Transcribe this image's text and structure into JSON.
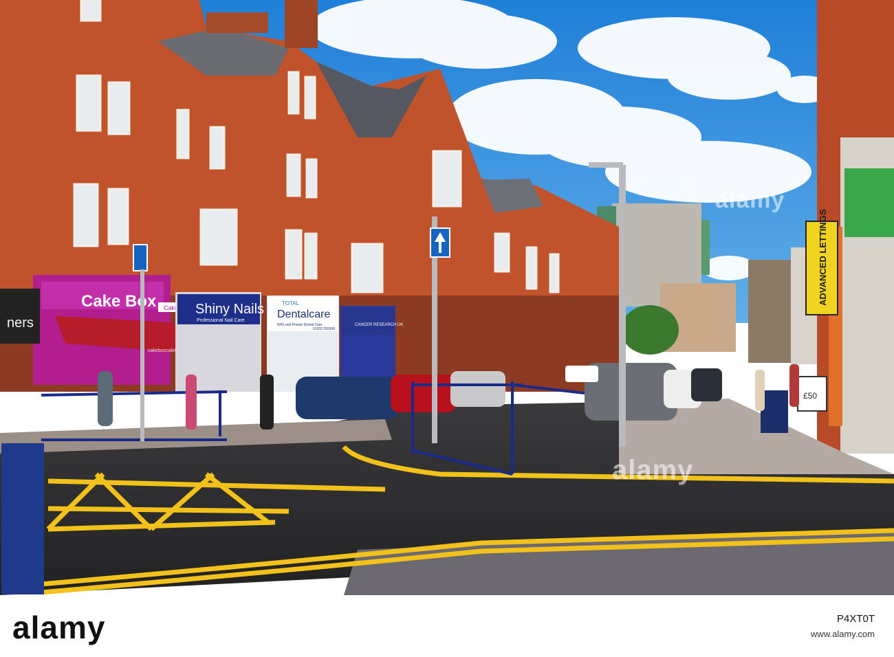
{
  "signs": {
    "cake_box": "Cake Box",
    "cake_box_small": "Cake Box",
    "cake_box_url": "cakeboxcake.co.uk",
    "shiny_nails": "Shiny Nails",
    "shiny_nails_sub": "Professional Nail Care",
    "dentalcare_brand": "TOTAL",
    "dentalcare": "Dentalcare",
    "dentalcare_sub": "NHS and Private Dental Care",
    "dentalcare_phone": "01202 255599",
    "cancer_research": "CANCER RESEARCH UK",
    "advanced_lettings": "ADVANCED LETTINGS",
    "price_board": "£50",
    "shop_fragment": "ners"
  },
  "watermarks": {
    "top": "alamy",
    "mid": "alamy"
  },
  "footer": {
    "logo": "alamy",
    "image_id": "P4XT0T",
    "site": "www.alamy.com"
  },
  "colors": {
    "sky": "#2f8fe0",
    "brick": "#c0532c",
    "road": "#2b2b2e",
    "yellow_lines": "#f2c21b",
    "railing_blue": "#1a2a8a"
  }
}
